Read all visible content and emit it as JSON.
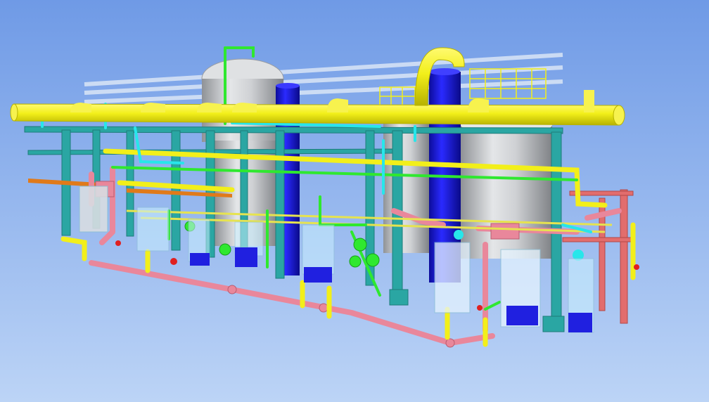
{
  "scene": {
    "kind": "3d-plant-piping-model",
    "background": {
      "top": "#6f9ae6",
      "bottom": "#bcd4f6"
    },
    "colors": {
      "main_header": "#f2ef1a",
      "header_shade": "#c9c400",
      "structure": "#2aa6a3",
      "structure_dark": "#1d7c7a",
      "pipe_pink": "#e9879b",
      "pipe_pink_dark": "#b95c70",
      "pipe_green": "#2fe82f",
      "pipe_cyan": "#27e6ea",
      "vessel_blue": "#1a1ad8",
      "vessel_grey": "#cfd1d4",
      "vessel_grey_dark": "#8f9296",
      "transparent_box": "#c9efff",
      "glass_box_blue": "#2020e0",
      "orange_beam": "#e07a1a",
      "salmon_frame": "#e26d6d",
      "translucent_beam": "#e6eef8"
    },
    "components": {
      "main_header": "yellow-header-pipe",
      "vessels": [
        "grey-vertical-vessel-left",
        "grey-vertical-vessel-right",
        "blue-column-left",
        "blue-column-right"
      ],
      "structure": "teal-pipe-rack",
      "secondary_piping": [
        "pink-piping",
        "green-piping",
        "cyan-piping"
      ]
    }
  }
}
